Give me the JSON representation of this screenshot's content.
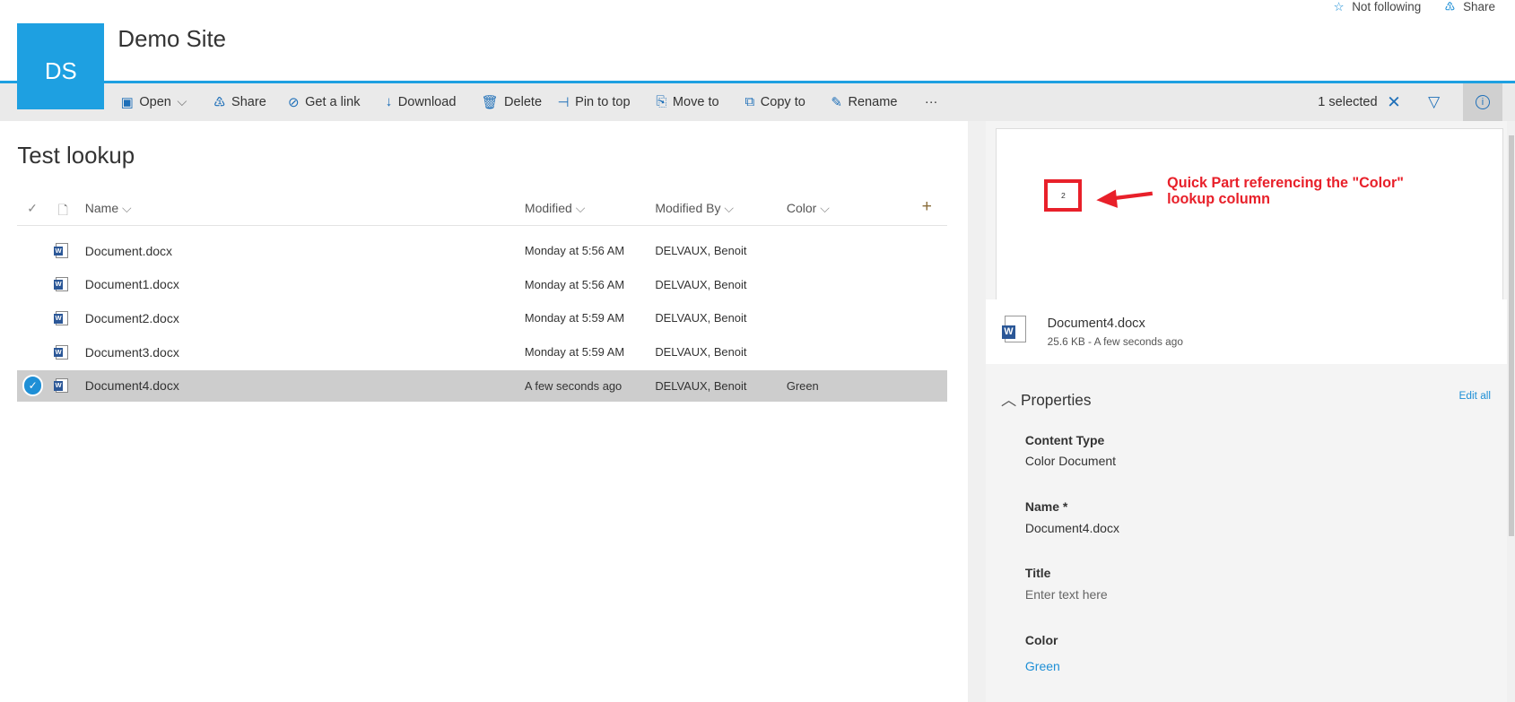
{
  "header": {
    "follow_label": "Not following",
    "share_label": "Share",
    "logo_text": "DS",
    "site_title": "Demo Site"
  },
  "toolbar": {
    "open": "Open",
    "share": "Share",
    "get_link": "Get a link",
    "download": "Download",
    "delete": "Delete",
    "pin": "Pin to top",
    "move": "Move to",
    "copy": "Copy to",
    "rename": "Rename",
    "more": "···",
    "selected": "1 selected"
  },
  "list": {
    "title": "Test lookup",
    "columns": {
      "name": "Name",
      "modified": "Modified",
      "modified_by": "Modified By",
      "color": "Color"
    },
    "rows": [
      {
        "name": "Document.docx",
        "modified": "Monday at 5:56 AM",
        "by": "DELVAUX, Benoit",
        "color": ""
      },
      {
        "name": "Document1.docx",
        "modified": "Monday at 5:56 AM",
        "by": "DELVAUX, Benoit",
        "color": ""
      },
      {
        "name": "Document2.docx",
        "modified": "Monday at 5:59 AM",
        "by": "DELVAUX, Benoit",
        "color": ""
      },
      {
        "name": "Document3.docx",
        "modified": "Monday at 5:59 AM",
        "by": "DELVAUX, Benoit",
        "color": ""
      },
      {
        "name": "Document4.docx",
        "modified": "A few seconds ago",
        "by": "DELVAUX, Benoit",
        "color": "Green",
        "selected": true
      }
    ]
  },
  "details": {
    "preview_value": "2",
    "annotation": "Quick Part referencing the \"Color\" lookup column",
    "file_name": "Document4.docx",
    "file_meta": "25.6 KB - A few seconds ago",
    "properties_label": "Properties",
    "edit_all": "Edit all",
    "fields": [
      {
        "label": "Content Type",
        "value": "Color Document"
      },
      {
        "label": "Name *",
        "value": "Document4.docx"
      },
      {
        "label": "Title",
        "value": "Enter text here"
      },
      {
        "label": "Color",
        "value": "Green"
      }
    ]
  }
}
